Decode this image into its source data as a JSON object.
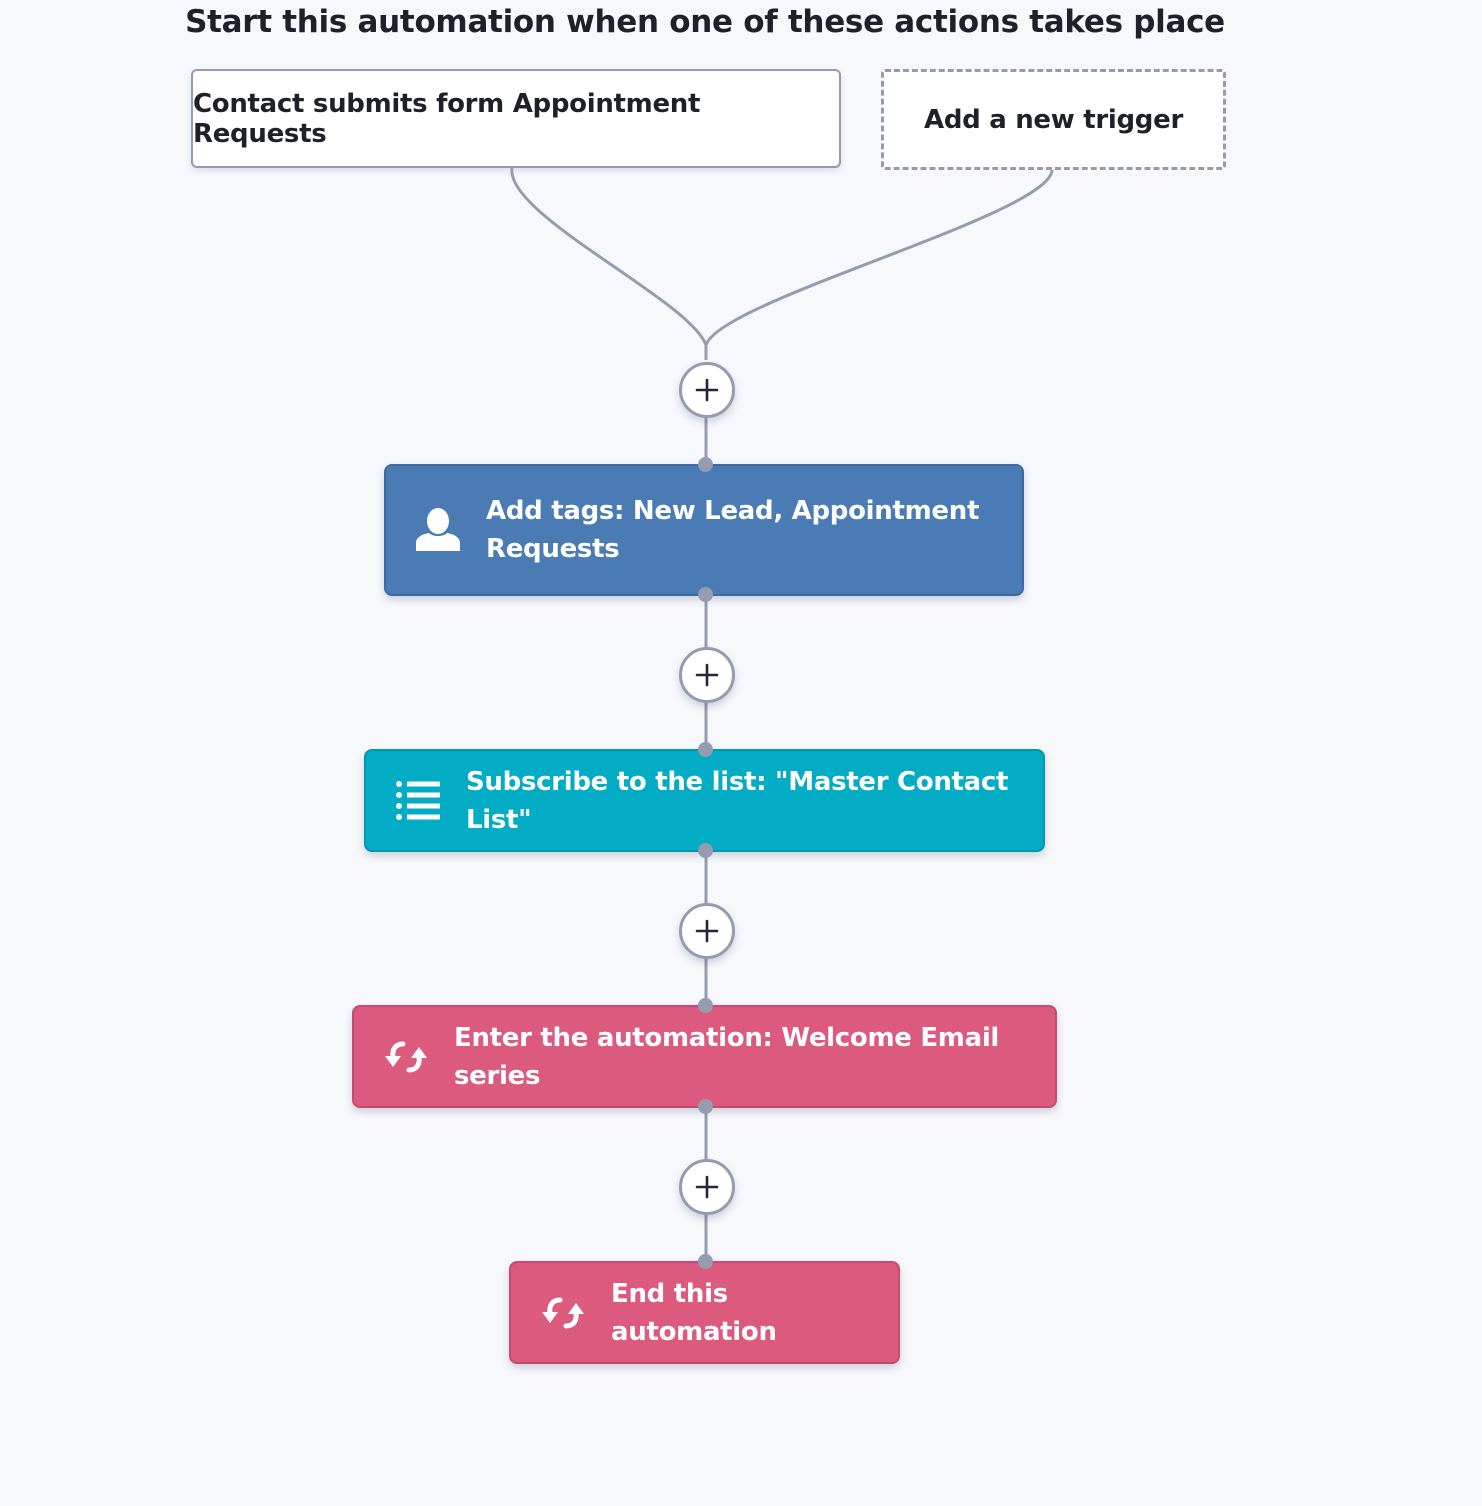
{
  "heading": "Start this automation when one of these actions takes place",
  "triggers": [
    {
      "label": "Contact submits form Appointment Requests",
      "style": "solid"
    },
    {
      "label": "Add a new trigger",
      "style": "dashed"
    }
  ],
  "add_step_icon": "plus-icon",
  "actions": [
    {
      "label": "Add tags: New Lead, Appointment Requests",
      "icon": "user-icon",
      "color": "#4a7bb5"
    },
    {
      "label": "Subscribe to the list: \"Master Contact List\"",
      "icon": "list-icon",
      "color": "#02acc4"
    },
    {
      "label": "Enter the automation: Welcome Email series",
      "icon": "refresh-arrows-icon",
      "color": "#db5a7e"
    },
    {
      "label": "End this automation",
      "icon": "refresh-arrows-icon",
      "color": "#db5a7e"
    }
  ],
  "colors": {
    "background": "#f6f8fc",
    "connector": "#959cb0",
    "text": "#1f2129"
  }
}
